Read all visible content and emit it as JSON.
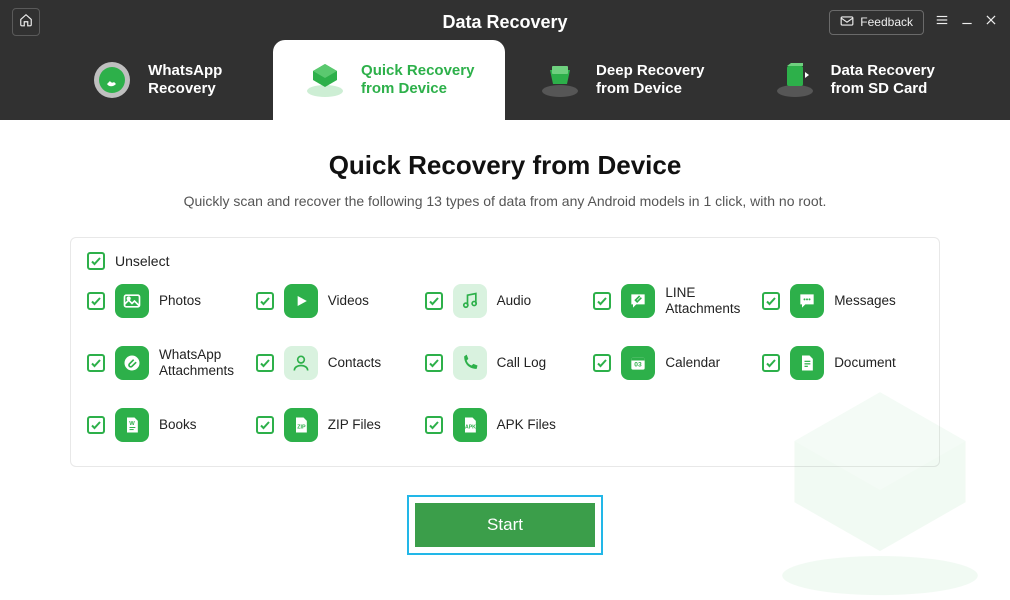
{
  "app_title": "Data Recovery",
  "controls": {
    "feedback": "Feedback"
  },
  "tabs": [
    {
      "line1": "WhatsApp",
      "line2": "Recovery",
      "active": false
    },
    {
      "line1": "Quick Recovery",
      "line2": "from Device",
      "active": true
    },
    {
      "line1": "Deep Recovery",
      "line2": "from Device",
      "active": false
    },
    {
      "line1": "Data Recovery",
      "line2": "from SD Card",
      "active": false
    }
  ],
  "main": {
    "title": "Quick Recovery from Device",
    "subtitle": "Quickly scan and recover the following 13 types of data from any Android models in 1 click, with no root."
  },
  "unselect_label": "Unselect",
  "items": [
    {
      "label": "Photos"
    },
    {
      "label": "Videos"
    },
    {
      "label": "Audio"
    },
    {
      "label": "LINE Attachments"
    },
    {
      "label": "Messages"
    },
    {
      "label": "WhatsApp Attachments"
    },
    {
      "label": "Contacts"
    },
    {
      "label": "Call Log"
    },
    {
      "label": "Calendar"
    },
    {
      "label": "Document"
    },
    {
      "label": "Books"
    },
    {
      "label": "ZIP Files"
    },
    {
      "label": "APK Files"
    }
  ],
  "start_label": "Start",
  "colors": {
    "accent": "#2db04a",
    "highlight": "#22b7e8",
    "header": "#313131"
  }
}
